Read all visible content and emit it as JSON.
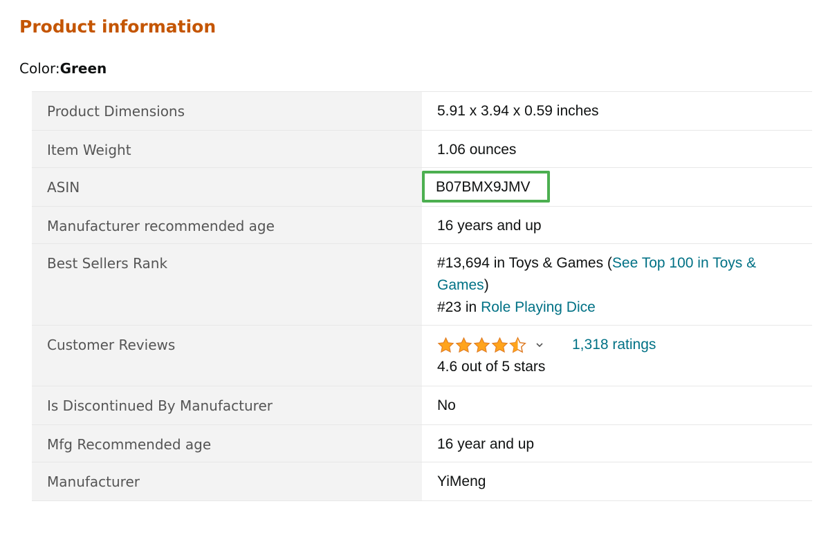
{
  "page": {
    "title": "Product information",
    "color_label": "Color:",
    "color_value": "Green"
  },
  "accent_colors": {
    "title": "#c45500",
    "link": "#007185",
    "highlight_box": "#4caf50",
    "star": "#ffa41c"
  },
  "rows": {
    "dimensions": {
      "label": "Product Dimensions",
      "value": "5.91 x 3.94 x 0.59 inches"
    },
    "weight": {
      "label": "Item Weight",
      "value": "1.06 ounces"
    },
    "asin": {
      "label": "ASIN",
      "value": "B07BMX9JMV"
    },
    "age": {
      "label": "Manufacturer recommended age",
      "value": "16 years and up"
    },
    "rank": {
      "label": "Best Sellers Rank",
      "line1_prefix": "#13,694 in Toys & Games (",
      "line1_link": "See Top 100 in Toys & Games",
      "line1_suffix": ")",
      "line2_prefix": "#23 in ",
      "line2_link": "Role Playing Dice"
    },
    "reviews": {
      "label": "Customer Reviews",
      "rating": 4.6,
      "ratings_link": "1,318 ratings",
      "rating_text": "4.6 out of 5 stars",
      "stars_icon": "star-rating-icon",
      "dropdown_icon": "chevron-down-icon"
    },
    "discontinued": {
      "label": "Is Discontinued By Manufacturer",
      "value": "No"
    },
    "mfg_age": {
      "label": "Mfg Recommended age",
      "value": "16 year and up"
    },
    "manufacturer": {
      "label": "Manufacturer",
      "value": "YiMeng"
    }
  }
}
